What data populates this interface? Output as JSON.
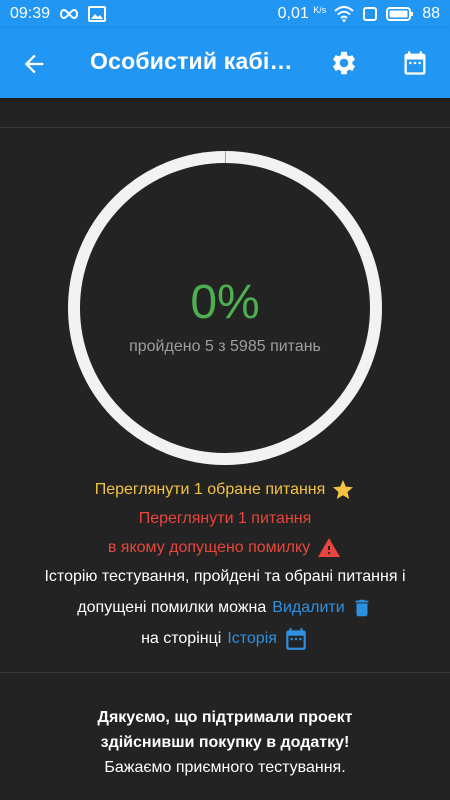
{
  "status_bar": {
    "time": "09:39",
    "net_rate": "0,01",
    "net_unit": "K/s",
    "battery": "88"
  },
  "app_bar": {
    "title": "Особистий кабі…"
  },
  "progress": {
    "percent_label": "0%",
    "percent_value": 0.08,
    "passed_text": "пройдено 5 з 5985 питань"
  },
  "info": {
    "favorites_text": "Переглянути 1 обране питання",
    "errors_line1": "Переглянути 1 питання",
    "errors_line2": "в якому допущено помилку",
    "history_line1": "Історію тестування, пройдені та обрані питання і",
    "history_line2_prefix": "допущені помилки можна",
    "delete_link": "Видалити",
    "history_line3_prefix": "на сторінці",
    "history_link": "Історія"
  },
  "thanks": {
    "line1": "Дякуємо, що підтримали проект",
    "line2": "здійснивши покупку в додатку!",
    "line3": "Бажаємо приємного тестування."
  },
  "colors": {
    "primary": "#2196f3",
    "background": "#232323",
    "success": "#4caf50",
    "favorite": "#f5c342",
    "error": "#e8453c",
    "link": "#2f8fe0"
  }
}
